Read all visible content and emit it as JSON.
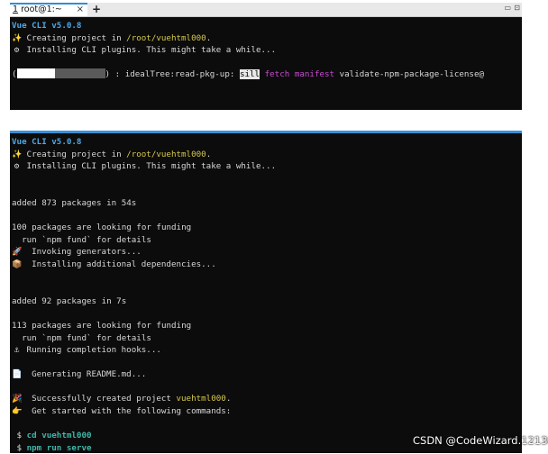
{
  "window1": {
    "tab": {
      "number": "1",
      "title": " root@1:~",
      "close": "×"
    },
    "new_tab": "+",
    "menu_icon": "▭",
    "scroll_icon": "⊡",
    "lines": {
      "vue": "Vue CLI v5.0.8",
      "creating_prefix": " Creating project in ",
      "creating_path": "/root/vuehtml000",
      "creating_suffix": ".",
      "installing": " Installing CLI plugins. This might take a while...",
      "progress_open": "(",
      "progress_close": ") ",
      "progress_sep": ":",
      "progress_text": " idealTree:read-pkg-up: ",
      "sill": "sill",
      "fetch": " fetch",
      "manifest": " manifest",
      "validate": " validate-npm-package-license@"
    },
    "progress_fraction": 0.43
  },
  "window2": {
    "lines": {
      "vue": "Vue CLI v5.0.8",
      "creating_prefix": " Creating project in ",
      "creating_path": "/root/vuehtml000",
      "creating_suffix": ".",
      "installing": " Installing CLI plugins. This might take a while...",
      "added1": "added 873 packages in 54s",
      "funding1": "100 packages are looking for funding",
      "fund1": "  run `npm fund` for details",
      "invoking": "  Invoking generators...",
      "installing_deps": "  Installing additional dependencies...",
      "added2": "added 92 packages in 7s",
      "funding2": "113 packages are looking for funding",
      "fund2": "  run `npm fund` for details",
      "hooks": " Running completion hooks...",
      "readme": "  Generating README.md...",
      "success_prefix": "  Successfully created project ",
      "success_name": "vuehtml000",
      "success_suffix": ".",
      "get_started": "  Get started with the following commands:",
      "prompt": " $ ",
      "cmd1": "cd vuehtml000",
      "cmd2": "npm run serve"
    },
    "icons": {
      "sparkle": "sparkle-icon",
      "gear": "gear-icon",
      "rocket": "rocket-icon",
      "package": "package-icon",
      "anchor": "anchor-icon",
      "document": "document-icon",
      "party": "party-icon",
      "pointing": "pointing-hand-icon"
    }
  },
  "watermark": "CSDN @CodeWizard.12138"
}
